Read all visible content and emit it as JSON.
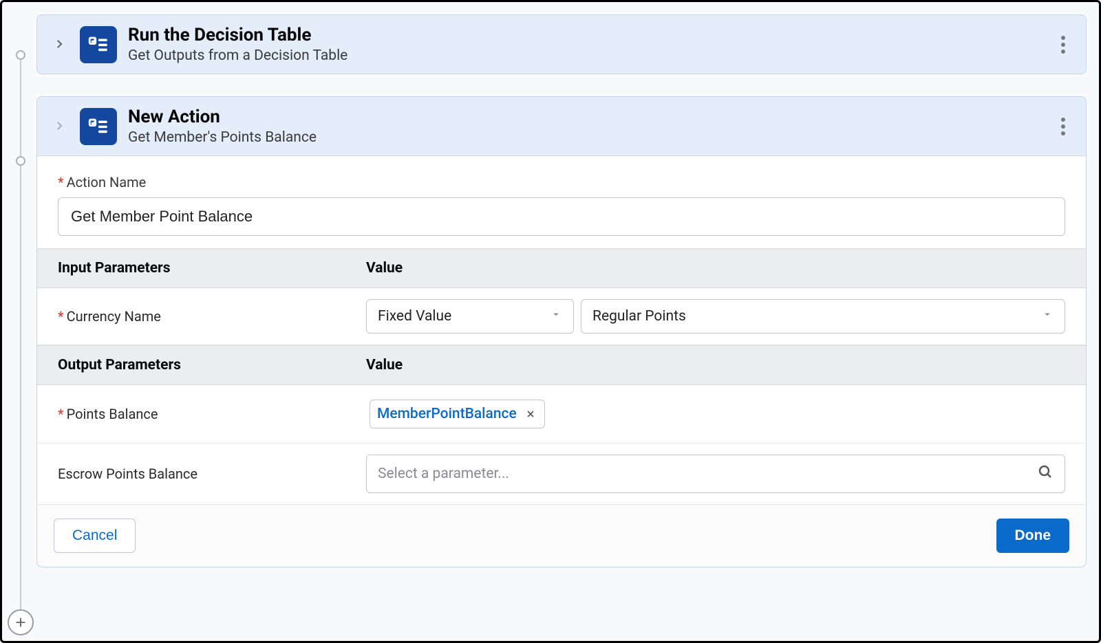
{
  "card1": {
    "title": "Run the Decision Table",
    "subtitle": "Get Outputs from a Decision Table"
  },
  "card2": {
    "title": "New Action",
    "subtitle": "Get Member's Points Balance",
    "action_name_label": "Action Name",
    "action_name_value": "Get Member Point Balance",
    "input_params_header": "Input Parameters",
    "value_header": "Value",
    "output_params_header": "Output Parameters",
    "currency_name_label": "Currency Name",
    "currency_mode": "Fixed Value",
    "currency_value": "Regular Points",
    "points_balance_label": "Points Balance",
    "points_balance_token": "MemberPointBalance",
    "escrow_label": "Escrow Points Balance",
    "escrow_placeholder": "Select a parameter...",
    "cancel_label": "Cancel",
    "done_label": "Done"
  }
}
